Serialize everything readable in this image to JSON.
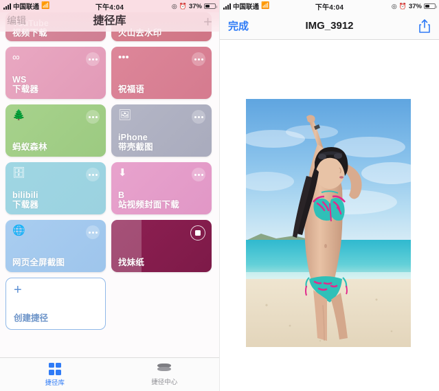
{
  "left": {
    "status": {
      "carrier": "中国联通",
      "wifi_icon": "wifi-icon",
      "time": "下午4:04",
      "location_icon": "location-icon",
      "alarm_icon": "alarm-icon",
      "battery_percent": "37%",
      "battery_icon": "battery-icon"
    },
    "nav": {
      "edit_label": "编辑",
      "title": "捷径库",
      "add_icon": "plus-icon"
    },
    "tiles": [
      {
        "label": "YouTube\n视频下载",
        "color": "#d98a9d",
        "color2": "#cf7e92",
        "icon": "",
        "clipped": true,
        "running": false
      },
      {
        "label": "火山去水印",
        "color": "#d8808f",
        "color2": "#cf7585",
        "icon": "",
        "clipped": true,
        "running": false
      },
      {
        "label": "WS\n下载器",
        "color": "#e9a8c2",
        "color2": "#e29ab7",
        "icon": "∞",
        "clipped": false,
        "running": false
      },
      {
        "label": "祝福语",
        "color": "#dd8699",
        "color2": "#d57b8f",
        "icon": "•••",
        "clipped": false,
        "running": false
      },
      {
        "label": "蚂蚁森林",
        "color": "#a7d28c",
        "color2": "#9cca81",
        "icon": "🌲",
        "clipped": false,
        "running": false
      },
      {
        "label": "iPhone\n带壳截图",
        "color": "#b4b6c6",
        "color2": "#a9abbd",
        "icon": "🖼",
        "clipped": false,
        "running": false
      },
      {
        "label": "bilibili\n下载器",
        "color": "#9fd6e3",
        "color2": "#9bd2e0",
        "icon": "🗄",
        "clipped": false,
        "running": false
      },
      {
        "label": "B\n站视频封面下载",
        "color": "#e8a3cd",
        "color2": "#e197c6",
        "icon": "⬇",
        "clipped": false,
        "running": false
      },
      {
        "label": "网页全屏截图",
        "color": "#a9cdf0",
        "color2": "#9ec5ec",
        "icon": "🌐",
        "clipped": false,
        "running": false
      },
      {
        "label": "找妹纸",
        "color": "#8e1f52",
        "color2": "#7d1a48",
        "icon": "",
        "clipped": false,
        "running": true,
        "progress_percent": 30,
        "stop_icon": "stop-icon"
      }
    ],
    "create": {
      "label": "创建捷径",
      "icon": "plus-icon"
    },
    "tabs": [
      {
        "label": "捷径库",
        "icon": "grid-icon",
        "active": true
      },
      {
        "label": "捷径中心",
        "icon": "layers-icon",
        "active": false
      }
    ]
  },
  "right": {
    "status": {
      "carrier": "中国联通",
      "wifi_icon": "wifi-icon",
      "time": "下午4:04",
      "location_icon": "location-icon",
      "alarm_icon": "alarm-icon",
      "battery_percent": "37%",
      "battery_icon": "battery-icon"
    },
    "nav": {
      "done_label": "完成",
      "title": "IMG_3912",
      "share_icon": "share-icon"
    },
    "photo": {
      "alt_name": "beach-portrait-photo",
      "sky_color": "#7fb8e8",
      "sea_color": "#3fb8c8",
      "sand_color": "#e9ddc5",
      "swimsuit_color": "#2fc0b8",
      "swimsuit_accent": "#e12a8c"
    }
  }
}
